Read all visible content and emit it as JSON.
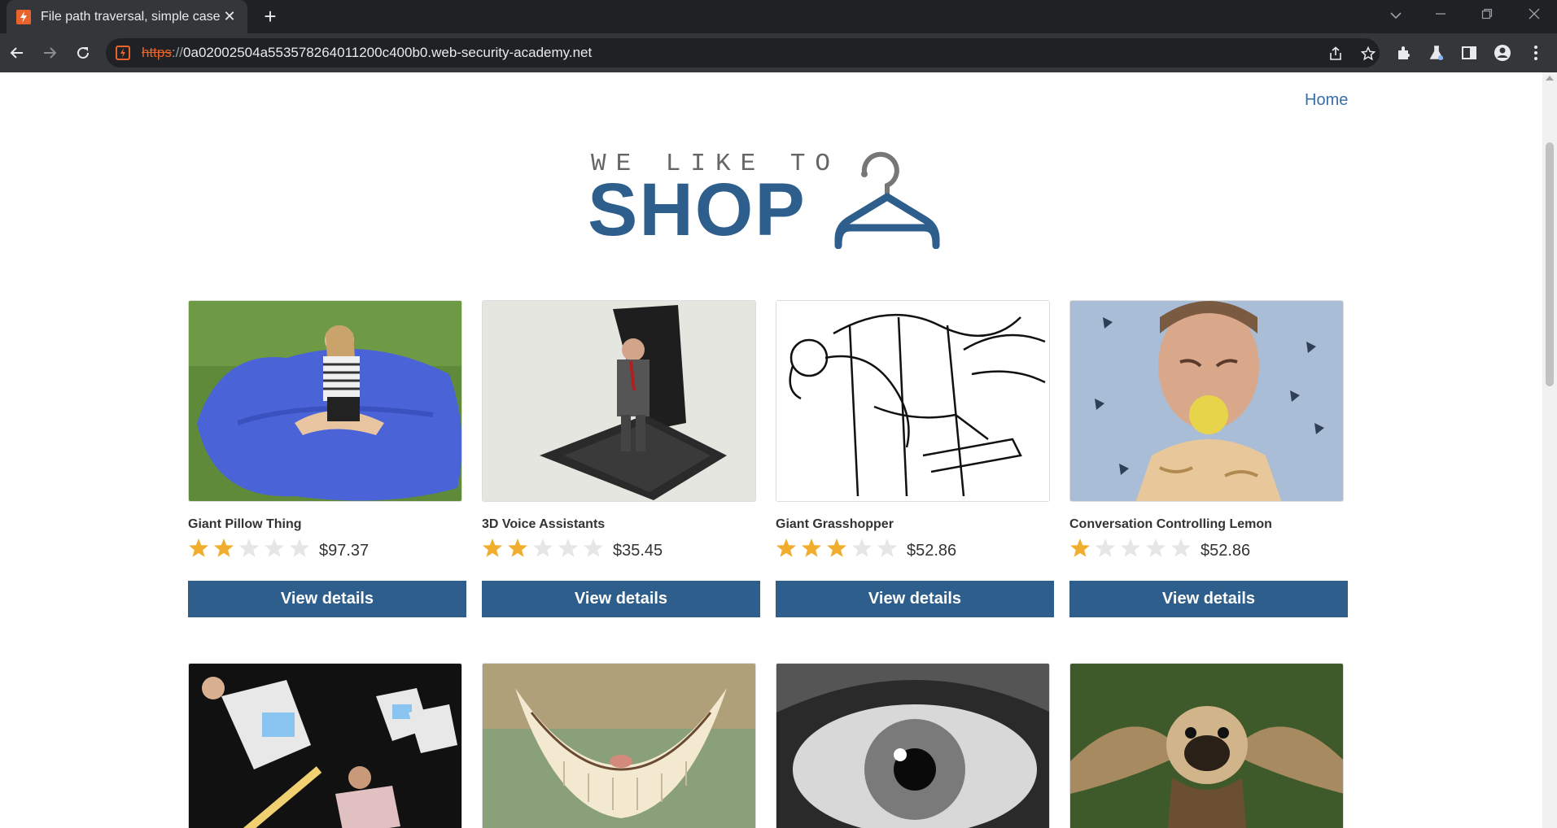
{
  "browser": {
    "tab_title": "File path traversal, simple case",
    "tab_close": "✕",
    "new_tab": "+",
    "url_scheme": "https",
    "url_sep": "://",
    "url_host": "0a02002504a553578264011200c400b0.web-security-academy.net"
  },
  "nav": {
    "home_label": "Home"
  },
  "logo": {
    "top_text": "WE LIKE TO",
    "main_text": "SHOP",
    "hanger_icon": "hanger-icon"
  },
  "colors": {
    "accent": "#2e5e8b",
    "star_on": "#f0ad2e",
    "star_off": "#e6e6e6",
    "link": "#3a6ea8"
  },
  "products": [
    {
      "name": "Giant Pillow Thing",
      "rating": 2,
      "price": "$97.37",
      "button": "View details"
    },
    {
      "name": "3D Voice Assistants",
      "rating": 2,
      "price": "$35.45",
      "button": "View details"
    },
    {
      "name": "Giant Grasshopper",
      "rating": 3,
      "price": "$52.86",
      "button": "View details"
    },
    {
      "name": "Conversation Controlling Lemon",
      "rating": 1,
      "price": "$52.86",
      "button": "View details"
    }
  ]
}
